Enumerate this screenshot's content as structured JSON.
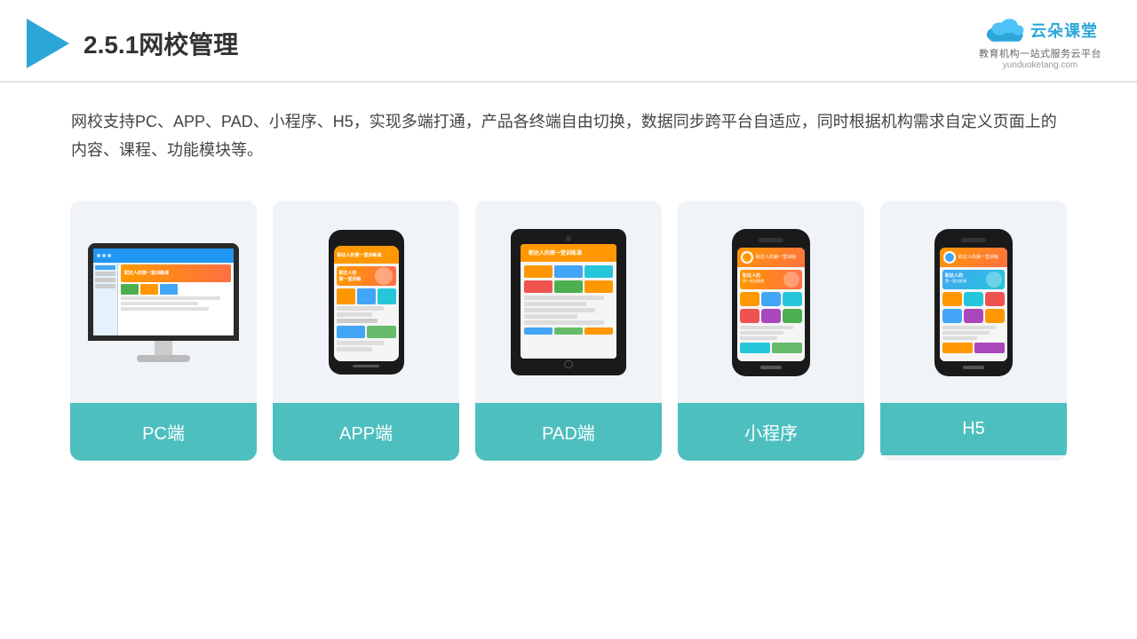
{
  "header": {
    "title": "2.5.1网校管理",
    "brand": {
      "name": "云朵课堂",
      "url": "yunduoketang.com",
      "tagline": "教育机构一站式服务云平台"
    }
  },
  "description": "网校支持PC、APP、PAD、小程序、H5，实现多端打通，产品各终端自由切换，数据同步跨平台自适应，同时根据机构需求自定义页面上的内容、课程、功能模块等。",
  "cards": [
    {
      "id": "pc",
      "label": "PC端"
    },
    {
      "id": "app",
      "label": "APP端"
    },
    {
      "id": "pad",
      "label": "PAD端"
    },
    {
      "id": "miniprogram",
      "label": "小程序"
    },
    {
      "id": "h5",
      "label": "H5"
    }
  ],
  "colors": {
    "teal": "#4dbfbf",
    "accent_blue": "#2ca6d9",
    "title_color": "#333"
  }
}
